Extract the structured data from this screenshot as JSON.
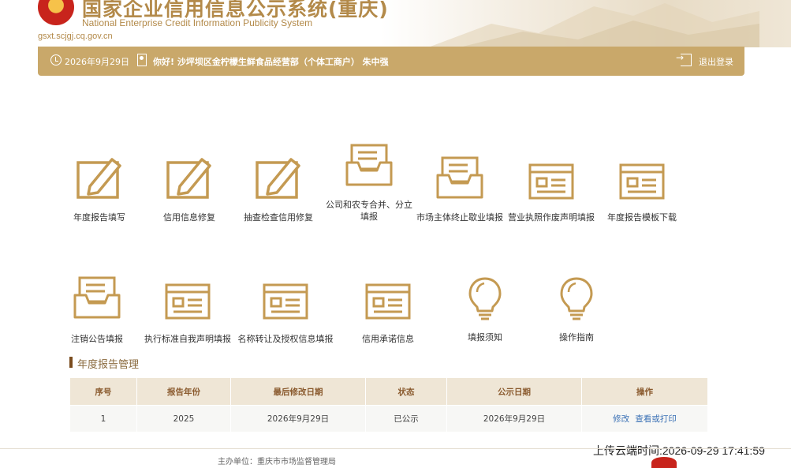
{
  "header": {
    "title": "国家企业信用信息公示系统(重庆)",
    "subtitle": "National Enterprise Credit Information Publicity System",
    "url": "gsxt.scjgj.cq.gov.cn"
  },
  "statusbar": {
    "date": "2026年9月29日",
    "greeting": "你好! 沙坪坝区金柠檬生鲜食品经营部（个体工商户）  朱中强",
    "logout": "退出登录"
  },
  "functions_row1": [
    {
      "label": "年度报告填写",
      "icon": "edit-icon"
    },
    {
      "label": "信用信息修复",
      "icon": "edit-icon"
    },
    {
      "label": "抽查检查信用修复",
      "icon": "edit-icon"
    },
    {
      "label": "公司和农专合并、分立填报",
      "icon": "inbox-icon"
    },
    {
      "label": "市场主体终止歇业填报",
      "icon": "inbox-icon"
    },
    {
      "label": "营业执照作废声明填报",
      "icon": "form-icon"
    },
    {
      "label": "年度报告模板下载",
      "icon": "form-icon"
    }
  ],
  "functions_row2": [
    {
      "label": "注销公告填报",
      "icon": "inbox-icon"
    },
    {
      "label": "执行标准自我声明填报",
      "icon": "form-icon"
    },
    {
      "label": "名称转让及授权信息填报",
      "icon": "form-icon"
    },
    {
      "label": "信用承诺信息",
      "icon": "form-icon"
    },
    {
      "label": "填报须知",
      "icon": "lightbulb-icon"
    },
    {
      "label": "操作指南",
      "icon": "lightbulb-icon"
    }
  ],
  "section": {
    "title": "年度报告管理"
  },
  "table": {
    "headers": [
      "序号",
      "报告年份",
      "最后修改日期",
      "状态",
      "公示日期",
      "操作"
    ],
    "rows": [
      {
        "index": "1",
        "year": "2025",
        "modified": "2026年9月29日",
        "status": "已公示",
        "published": "2026年9月29日",
        "action_edit": "修改",
        "action_view": "查看或打印"
      }
    ]
  },
  "upload_time": "上传云端时间:2026-09-29 17:41:59",
  "footer": {
    "text": "主办单位：重庆市市场监督管理局"
  },
  "colors": {
    "gold": "#c9a86a",
    "icon": "#c49a52",
    "title": "#b38a4a"
  }
}
